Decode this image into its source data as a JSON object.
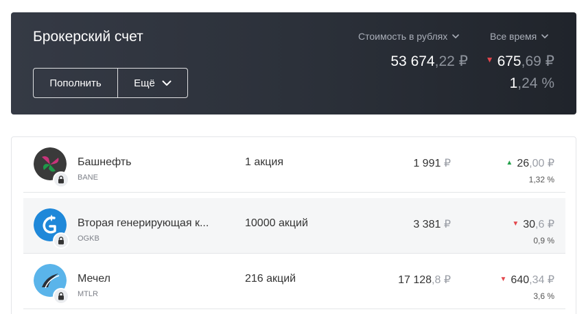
{
  "colors": {
    "header_bg": "#2b3039",
    "up": "#24a04a",
    "down": "#e3464c"
  },
  "header": {
    "title": "Брокерский счет",
    "deposit_label": "Пополнить",
    "more_label": "Ещё",
    "value_selector": "Стоимость в рублях",
    "period_selector": "Все время",
    "total_int": "53 674",
    "total_frac": ",22 ₽",
    "change_direction": "down",
    "change_int": "675",
    "change_frac": ",69 ₽",
    "change_pct_int": "1",
    "change_pct_frac": ",24 %"
  },
  "positions": [
    {
      "name": "Башнефть",
      "ticker": "BANE",
      "quantity": "1 акция",
      "price_int": "1 991",
      "price_frac": " ₽",
      "change_direction": "up",
      "change_int": "26",
      "change_frac": ",00 ₽",
      "change_pct": "1,32 %",
      "logo_icon": "bashneft-logo-icon"
    },
    {
      "name": "Вторая генерирующая к...",
      "ticker": "OGKB",
      "quantity": "10000 акций",
      "price_int": "3 381",
      "price_frac": " ₽",
      "change_direction": "down",
      "change_int": "30",
      "change_frac": ",6 ₽",
      "change_pct": "0,9 %",
      "logo_icon": "ogk2-logo-icon"
    },
    {
      "name": "Мечел",
      "ticker": "MTLR",
      "quantity": "216 акций",
      "price_int": "17 128",
      "price_frac": ",8 ₽",
      "change_direction": "down",
      "change_int": "640",
      "change_frac": ",34 ₽",
      "change_pct": "3,6 %",
      "logo_icon": "mechel-logo-icon"
    }
  ]
}
